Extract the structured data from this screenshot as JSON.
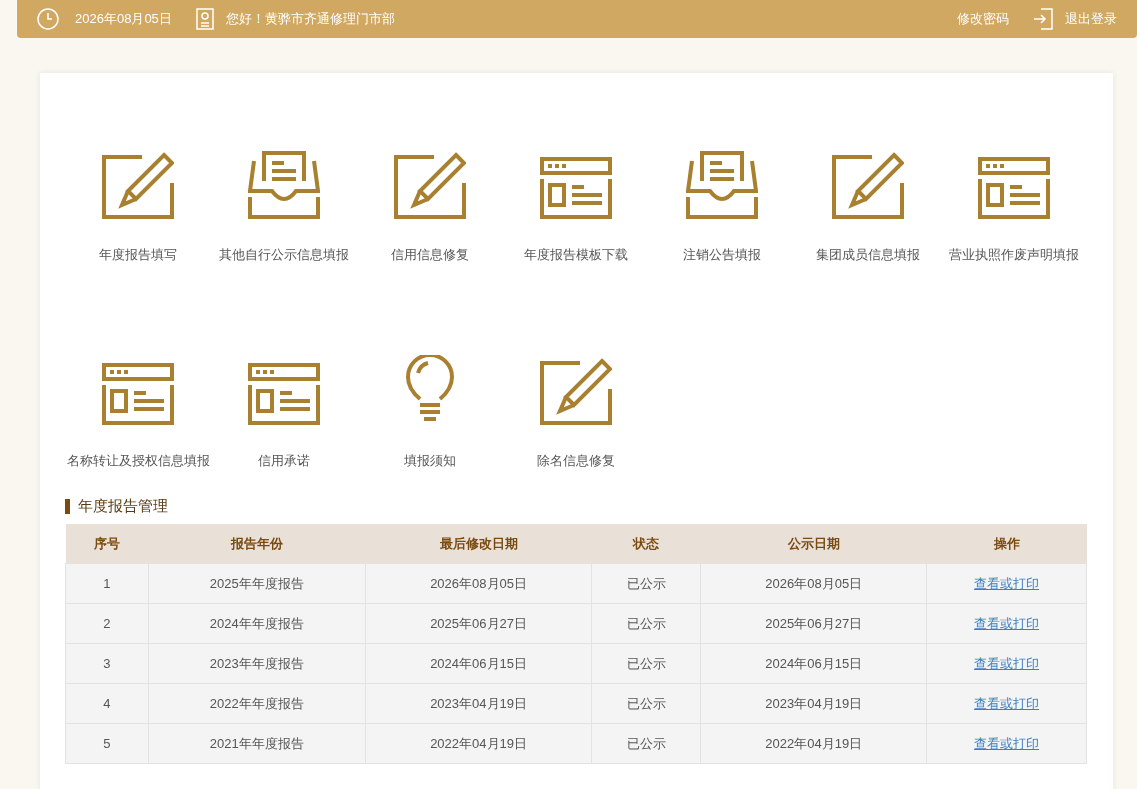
{
  "header": {
    "date": "2026年08月05日",
    "greeting": "您好！黄骅市齐通修理门市部",
    "links": [
      "修改密码",
      "退出登录"
    ]
  },
  "functions": [
    {
      "kind": "pencil",
      "label": "年度报告填写"
    },
    {
      "kind": "tray",
      "label": "其他自行公示信息填报"
    },
    {
      "kind": "pencil",
      "label": "信用信息修复"
    },
    {
      "kind": "form",
      "label": "年度报告模板下载"
    },
    {
      "kind": "tray",
      "label": "注销公告填报"
    },
    {
      "kind": "pencil",
      "label": "集团成员信息填报"
    },
    {
      "kind": "form",
      "label": "营业执照作废声明填报"
    },
    {
      "kind": "form",
      "label": "名称转让及授权信息填报"
    },
    {
      "kind": "form",
      "label": "信用承诺"
    },
    {
      "kind": "bulb",
      "label": "填报须知"
    },
    {
      "kind": "pencil",
      "label": "除名信息修复"
    }
  ],
  "section_title": "年度报告管理",
  "table": {
    "columns": [
      "序号",
      "报告年份",
      "最后修改日期",
      "状态",
      "公示日期",
      "操作"
    ],
    "rows": [
      [
        "1",
        "2025年年度报告",
        "2026年08月05日",
        "已公示",
        "2026年08月05日",
        "查看或打印"
      ],
      [
        "2",
        "2024年年度报告",
        "2025年06月27日",
        "已公示",
        "2025年06月27日",
        "查看或打印"
      ],
      [
        "3",
        "2023年年度报告",
        "2024年06月15日",
        "已公示",
        "2024年06月15日",
        "查看或打印"
      ],
      [
        "4",
        "2022年年度报告",
        "2023年04月19日",
        "已公示",
        "2023年04月19日",
        "查看或打印"
      ],
      [
        "5",
        "2021年年度报告",
        "2022年04月19日",
        "已公示",
        "2022年04月19日",
        "查看或打印"
      ]
    ]
  }
}
